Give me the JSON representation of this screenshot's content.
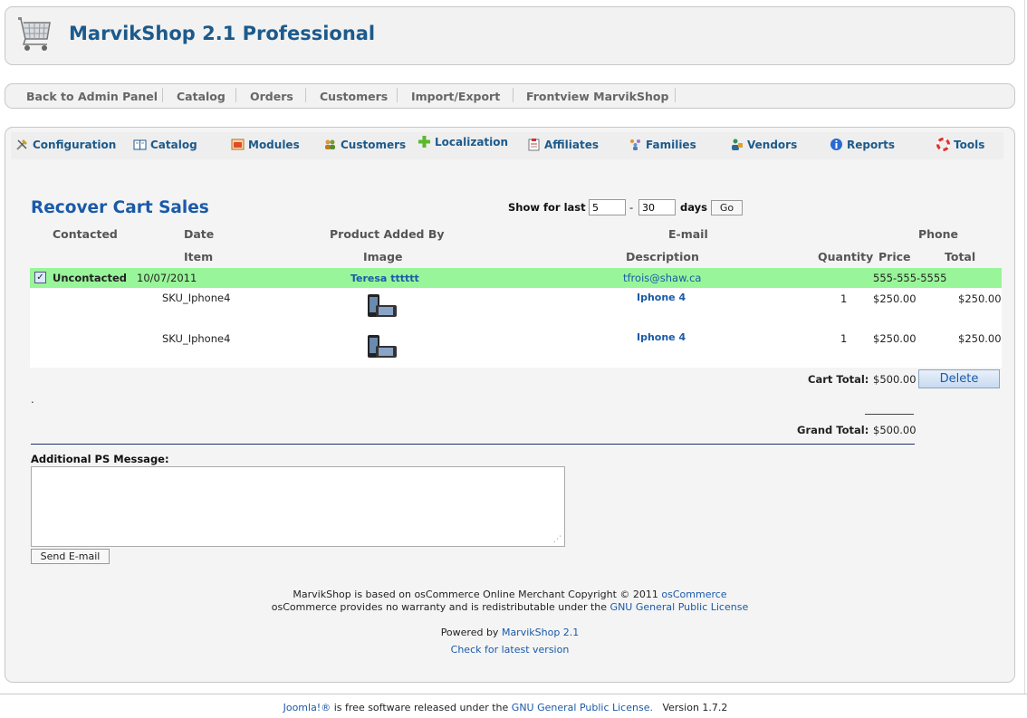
{
  "header": {
    "title": "MarvikShop 2.1 Professional",
    "logo": "shopping-cart-icon"
  },
  "topnav": {
    "items": [
      "Back to Admin Panel",
      "Catalog",
      "Orders",
      "Customers",
      "Import/Export",
      "Frontview MarvikShop"
    ]
  },
  "menu": {
    "items": [
      {
        "label": "Configuration",
        "icon": "tools-icon"
      },
      {
        "label": "Catalog",
        "icon": "book-icon"
      },
      {
        "label": "Modules",
        "icon": "modules-icon"
      },
      {
        "label": "Customers",
        "icon": "users-icon"
      },
      {
        "label": "Localization",
        "icon": "plus-icon"
      },
      {
        "label": "Affiliates",
        "icon": "clipboard-icon"
      },
      {
        "label": "Families",
        "icon": "family-icon"
      },
      {
        "label": "Vendors",
        "icon": "vendor-icon"
      },
      {
        "label": "Reports",
        "icon": "info-icon"
      },
      {
        "label": "Tools",
        "icon": "lifebuoy-icon"
      }
    ]
  },
  "page": {
    "title": "Recover Cart Sales"
  },
  "filter": {
    "label": "Show for last",
    "from": "5",
    "dash": "-",
    "to": "30",
    "unit": "days",
    "go": "Go"
  },
  "table": {
    "headers_row1": {
      "contacted": "Contacted",
      "date": "Date",
      "added_by": "Product Added By",
      "email": "E-mail",
      "phone": "Phone"
    },
    "headers_row2": {
      "item": "Item",
      "image": "Image",
      "description": "Description",
      "quantity": "Quantity",
      "price": "Price",
      "total": "Total"
    },
    "customer": {
      "checked": "✓",
      "status": "Uncontacted",
      "date": "10/07/2011",
      "name": "Teresa tttttt",
      "email": "tfrois@shaw.ca",
      "phone": "555-555-5555"
    },
    "items": [
      {
        "sku": "SKU_Iphone4",
        "description": "Iphone 4",
        "quantity": "1",
        "price": "$250.00",
        "total": "$250.00"
      },
      {
        "sku": "SKU_Iphone4",
        "description": "Iphone 4",
        "quantity": "1",
        "price": "$250.00",
        "total": "$250.00"
      }
    ],
    "cart_total_label": "Cart Total:",
    "cart_total": "$500.00",
    "delete": "Delete",
    "dot": ".",
    "grand_total_label": "Grand Total:",
    "grand_total": "$500.00"
  },
  "message": {
    "label": "Additional PS Message:",
    "value": "",
    "send": "Send E-mail"
  },
  "footer": {
    "line1_prefix": "MarvikShop is based on osCommerce Online Merchant Copyright © 2011",
    "line1_link": "osCommerce",
    "line2_prefix": "osCommerce provides no warranty and is redistributable under the",
    "line2_link": "GNU General Public License",
    "powered_prefix": "Powered by",
    "powered_link": "MarvikShop 2.1",
    "check_version": "Check for latest version",
    "joomla_link": "Joomla!®",
    "joomla_text": "is free software released under the",
    "joomla_license": "GNU General Public License.",
    "version": "Version 1.7.2"
  }
}
